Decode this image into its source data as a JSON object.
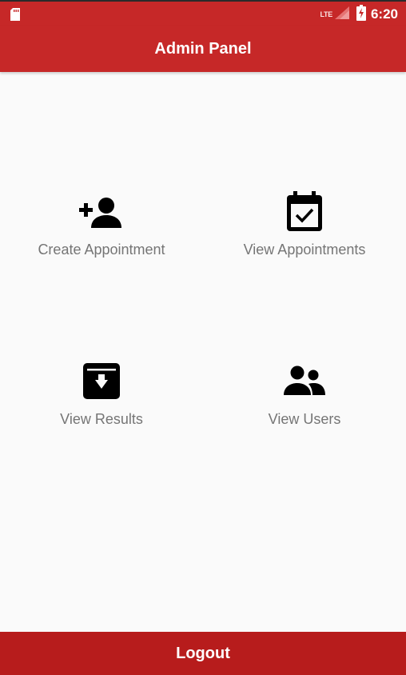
{
  "status_bar": {
    "network": "LTE",
    "time": "6:20",
    "icons": [
      "sd-card-icon",
      "signal-icon",
      "battery-charging-icon"
    ]
  },
  "app_bar": {
    "title": "Admin Panel"
  },
  "menu": [
    {
      "label": "Create Appointment",
      "icon": "add-person-icon"
    },
    {
      "label": "View Appointments",
      "icon": "calendar-check-icon"
    },
    {
      "label": "View Results",
      "icon": "archive-icon"
    },
    {
      "label": "View Users",
      "icon": "supervisor-account-icon"
    }
  ],
  "logout": {
    "label": "Logout"
  },
  "colors": {
    "app_bar": "#c62828",
    "logout_bar": "#b71c1c",
    "background": "#fafafa",
    "label_text": "#757575",
    "icon": "#000000"
  }
}
